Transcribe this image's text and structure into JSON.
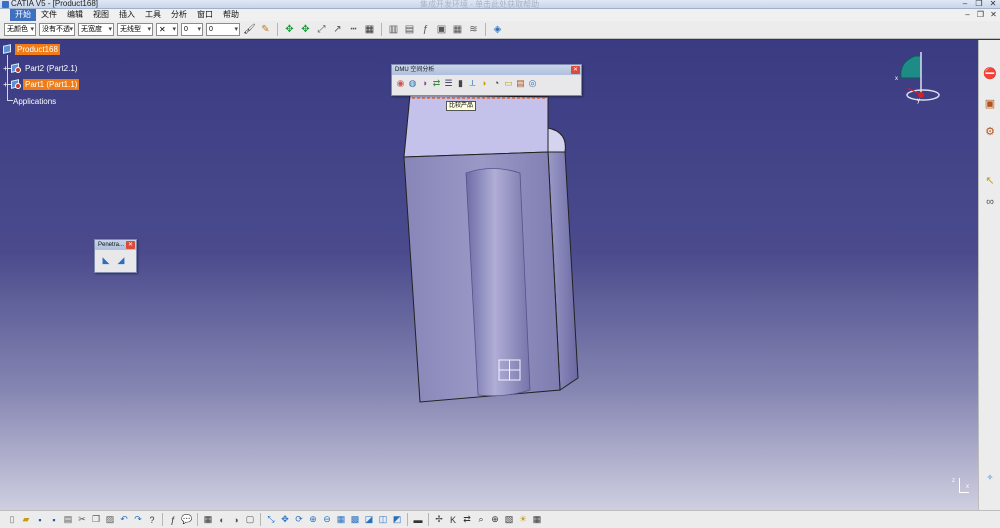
{
  "window": {
    "title": "CATIA V5 - [Product168]",
    "faint_text": "集成开发环境 - 单击此处获取帮助"
  },
  "window_buttons": [
    "–",
    "❐",
    "✕"
  ],
  "menu": [
    "开始",
    "文件",
    "编辑",
    "视图",
    "插入",
    "工具",
    "分析",
    "窗口",
    "帮助"
  ],
  "toolbar": {
    "color_combo": "无颜色",
    "transparency_combo": "没有不透",
    "linewidth_combo": "无宽度",
    "linetype_combo": "无线型",
    "layer_combo": "0",
    "layer_value": "0"
  },
  "tree": {
    "product": "Product168",
    "part2": "Part2 (Part2.1)",
    "part1": "Part1 (Part1.1)",
    "applications": "Applications"
  },
  "dmu_toolbar": {
    "title": "DMU 空间分析",
    "tooltip": "比较产品"
  },
  "penetration_toolbar": {
    "title": "Penetra..."
  },
  "compass": {
    "axis_x": "x",
    "axis_y": "y"
  },
  "axis_mini": {
    "x": "x",
    "z": "z"
  },
  "colors": {
    "viewport_top": "#3a3b82",
    "viewport_bottom": "#cfcfe0",
    "selection": "#f07c17",
    "model_face": "#9a98c6"
  }
}
